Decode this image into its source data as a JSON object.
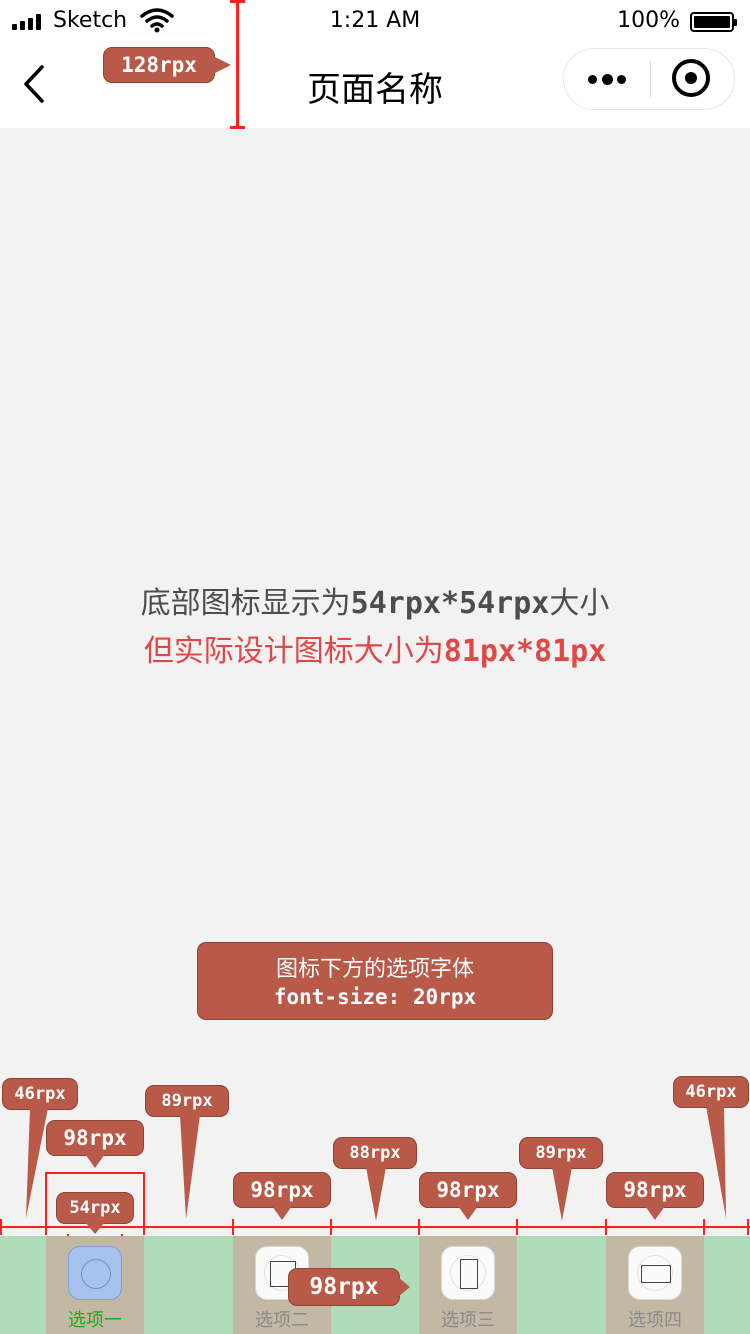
{
  "status_bar": {
    "carrier": "Sketch",
    "time": "1:21 AM",
    "battery": "100%",
    "icons": [
      "signal-icon",
      "wifi-icon",
      "battery-icon"
    ]
  },
  "nav": {
    "title": "页面名称",
    "icons": [
      "back-chevron-icon",
      "more-dots-icon",
      "close-target-icon"
    ],
    "height_label": "128rpx"
  },
  "notes": {
    "line1_prefix": "底部图标显示为",
    "line1_size": "54rpx*54rpx",
    "line1_suffix": "大小",
    "line2_prefix": "但实际设计图标大小为",
    "line2_size": "81px*81px",
    "font_note_line1": "图标下方的选项字体",
    "font_note_line2": "font-size: 20rpx"
  },
  "measurements": {
    "left_margin": "46rpx",
    "tab_width": "98rpx",
    "icon_width": "54rpx",
    "icon_height": "54rpx",
    "gap_1": "89rpx",
    "tab2_width": "98rpx",
    "gap_2": "88rpx",
    "tab3_width": "98rpx",
    "gap_3": "89rpx",
    "tab4_width": "98rpx",
    "right_margin": "46rpx",
    "bar_height": "98rpx"
  },
  "tabs": [
    {
      "label": "选项一",
      "active": true,
      "icon": "circle-icon"
    },
    {
      "label": "选项二",
      "active": false,
      "icon": "square-icon"
    },
    {
      "label": "选项三",
      "active": false,
      "icon": "portrait-rect-icon"
    },
    {
      "label": "选项四",
      "active": false,
      "icon": "landscape-rect-icon"
    }
  ],
  "colors": {
    "callout": "#b95a49",
    "measure_line": "#ff2020",
    "note_red": "#e04848",
    "tabbar_bg": "#b0dcb9",
    "tab_bg": "#c2b8a3",
    "active_label": "#1aad19"
  }
}
